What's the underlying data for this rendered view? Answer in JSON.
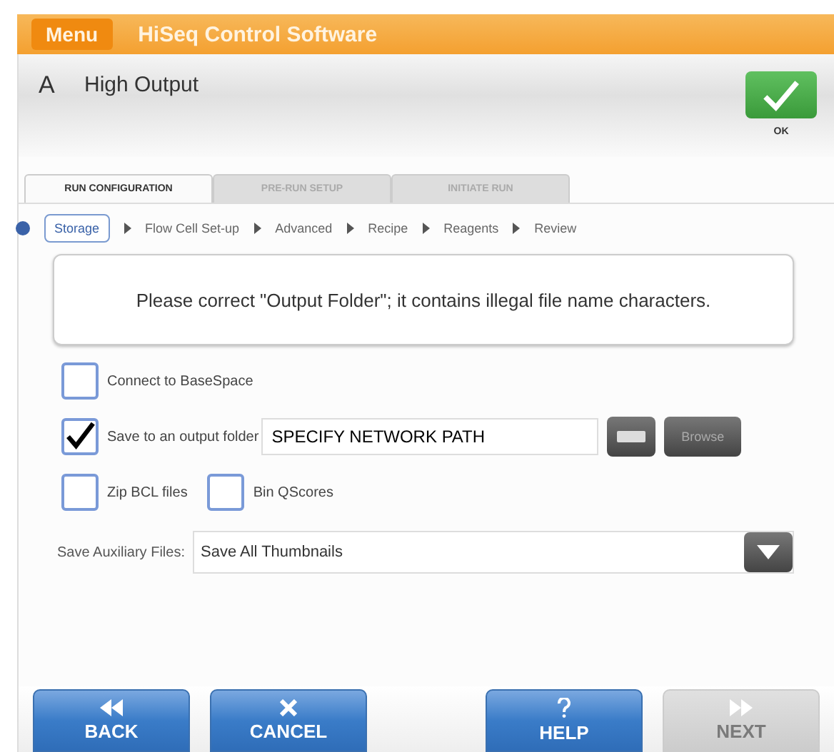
{
  "title_bar": {
    "menu": "Menu",
    "title": "HiSeq Control Software"
  },
  "header": {
    "side": "A",
    "run_mode": "High Output",
    "ok_label": "OK"
  },
  "tabs": [
    {
      "label": "RUN CONFIGURATION",
      "selected": true
    },
    {
      "label": "PRE-RUN SETUP",
      "selected": false
    },
    {
      "label": "INITIATE RUN",
      "selected": false
    }
  ],
  "steps": [
    {
      "label": "Storage",
      "selected": true
    },
    {
      "label": "Flow Cell Set-up",
      "selected": false
    },
    {
      "label": "Advanced",
      "selected": false
    },
    {
      "label": "Recipe",
      "selected": false
    },
    {
      "label": "Reagents",
      "selected": false
    },
    {
      "label": "Review",
      "selected": false
    }
  ],
  "message": "Please correct \"Output Folder\"; it contains illegal file name characters.",
  "options": [
    {
      "label": "Connect to BaseSpace",
      "checked": false
    },
    {
      "label": "Save to an output folder",
      "checked": true,
      "path": "SPECIFY NETWORK PATH",
      "browse": "Browse"
    },
    {
      "label": "Zip BCL files",
      "checked": false
    },
    {
      "label": "Bin QScores",
      "checked": false
    }
  ],
  "auxiliary": {
    "label": "Save Auxiliary Files:",
    "value": "Save All Thumbnails"
  },
  "buttons": [
    {
      "kind": "back",
      "label": "BACK",
      "disabled": false
    },
    {
      "kind": "cancel",
      "label": "CANCEL",
      "disabled": false
    },
    {
      "kind": "help",
      "label": "HELP",
      "disabled": false
    },
    {
      "kind": "next",
      "label": "NEXT",
      "disabled": true
    }
  ]
}
